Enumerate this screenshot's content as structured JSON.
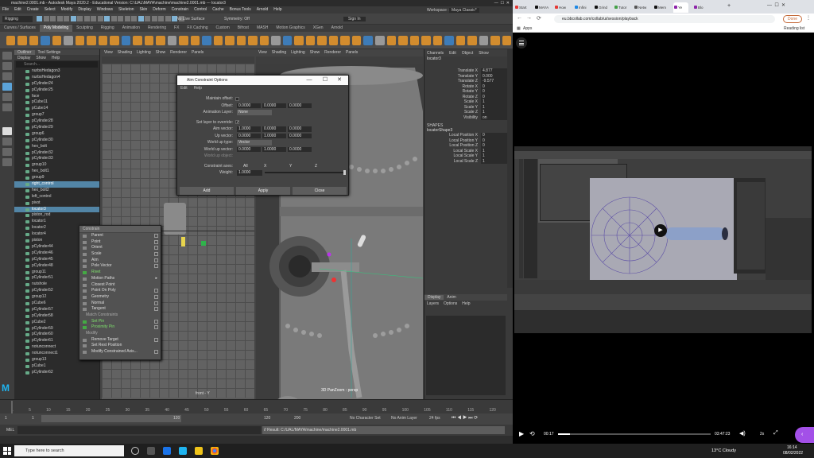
{
  "maya": {
    "title": "machine2.0001.mb - Autodesk Maya 2020.2 - Educational Version: C:\\UAL\\MAYA\\machine\\machine2.0001.mb --- locator3",
    "menu": [
      "File",
      "Edit",
      "Create",
      "Select",
      "Modify",
      "Display",
      "Windows",
      "Skeleton",
      "Skin",
      "Deform",
      "Constrain",
      "Control",
      "Cache",
      "Bonus Tools",
      "Arnold",
      "Help"
    ],
    "workspace_label": "Workspace :",
    "workspace_value": "Maya Classic*",
    "mode": "Rigging",
    "no_live_surface": "No Live Surface",
    "symmetry": "Symmetry: Off",
    "sign_in": "Sign In",
    "shelf_tabs": [
      "Curves / Surfaces",
      "Poly Modeling",
      "Sculpting",
      "Rigging",
      "Animation",
      "Rendering",
      "FX",
      "FX Caching",
      "Custom",
      "Bifrost",
      "MASH",
      "Motion Graphics",
      "XGen",
      "Arnold"
    ],
    "shelf_active": 1,
    "outliner": {
      "tabs": [
        "Outliner",
        "Tool Settings"
      ],
      "menus": [
        "Display",
        "Show",
        "Help"
      ],
      "search_placeholder": "Search...",
      "items": [
        "nurbsHedagon3",
        "nurbsHedagon4",
        "pCylinder24",
        "pCylinder25",
        "face",
        "pCube11",
        "pCube14",
        "group7",
        "pCylinder28",
        "pCylinder29",
        "group6",
        "pCylinder30",
        "hex_bolt",
        "pCylinder32",
        "pCylinder33",
        "group10",
        "hex_bolt1",
        "group9",
        "right_control",
        "hex_bolt2",
        "left_control",
        "pivot",
        "locator3",
        "piston_rod",
        "locator1",
        "locator2",
        "locator4",
        "piston",
        "pCylinder44",
        "pCylinder46",
        "pCylinder45",
        "pCylinder48",
        "group11",
        "pCylinder51",
        "nutshole",
        "pCylinder52",
        "group12",
        "pCube6",
        "pCylinder57",
        "pCylinder58",
        "pCube2",
        "pCylinder59",
        "pCylinder60",
        "pCylinder61",
        "notunconnect",
        "notunconnect1",
        "group13",
        "pCube1",
        "pCylinder62"
      ],
      "selected": [
        18,
        22
      ]
    },
    "viewport_menus": [
      "View",
      "Shading",
      "Lighting",
      "Show",
      "Renderer",
      "Panels"
    ],
    "vp1_label": "front - Y",
    "vp2_label": "3D PanZoom : persp",
    "channel_box": {
      "menus": [
        "Channels",
        "Edit",
        "Object",
        "Show"
      ],
      "object": "locator3",
      "rows": [
        [
          "Translate X",
          "4.877"
        ],
        [
          "Translate Y",
          "0.000"
        ],
        [
          "Translate Z",
          "-9.577"
        ],
        [
          "Rotate X",
          "0"
        ],
        [
          "Rotate Y",
          "0"
        ],
        [
          "Rotate Z",
          "0"
        ],
        [
          "Scale X",
          "1"
        ],
        [
          "Scale Y",
          "1"
        ],
        [
          "Scale Z",
          "1"
        ],
        [
          "Visibility",
          "on"
        ]
      ],
      "shapes_label": "SHAPES",
      "shape": "locatorShape3",
      "shape_rows": [
        [
          "Local Position X",
          "0"
        ],
        [
          "Local Position Y",
          "0"
        ],
        [
          "Local Position Z",
          "0"
        ],
        [
          "Local Scale X",
          "1"
        ],
        [
          "Local Scale Y",
          "1"
        ],
        [
          "Local Scale Z",
          "1"
        ]
      ],
      "layer_tabs": [
        "Display",
        "Anim"
      ],
      "layer_menus": [
        "Layers",
        "Options",
        "Help"
      ]
    },
    "timeline": {
      "ticks": [
        "1",
        "5",
        "10",
        "15",
        "20",
        "25",
        "30",
        "35",
        "40",
        "45",
        "50",
        "55",
        "60",
        "65",
        "70",
        "75",
        "80",
        "85",
        "90",
        "95",
        "100",
        "105",
        "110",
        "115",
        "120"
      ]
    },
    "range": {
      "start": "1",
      "inner_start": "1",
      "inner_end": "120",
      "end": "120",
      "end2": "200",
      "no_char": "No Character Set",
      "no_layer": "No Anim Layer",
      "fps": "24 fps"
    },
    "cmd_label": "MEL",
    "cmd_result": "// Result: C:/UAL/MAYA/machine/machine2.0001.mb"
  },
  "aim_dialog": {
    "title": "Aim Constraint Options",
    "menus": [
      "Edit",
      "Help"
    ],
    "rows": [
      {
        "label": "Maintain offset:",
        "values": []
      },
      {
        "label": "Offset:",
        "values": [
          "0.0000",
          "0.0000",
          "0.0000"
        ]
      },
      {
        "label": "Animation Layer:",
        "values": [
          "None"
        ]
      },
      {
        "label": "Set layer to override:",
        "values": []
      },
      {
        "label": "Aim vector:",
        "values": [
          "1.0000",
          "0.0000",
          "0.0000"
        ]
      },
      {
        "label": "Up vector:",
        "values": [
          "0.0000",
          "1.0000",
          "0.0000"
        ]
      },
      {
        "label": "World up type:",
        "values": [
          "Vector"
        ]
      },
      {
        "label": "World up vector:",
        "values": [
          "0.0000",
          "1.0000",
          "0.0000"
        ]
      },
      {
        "label": "World up object:",
        "values": []
      },
      {
        "label": "Constraint axes:",
        "values": [
          "All",
          "X",
          "Y",
          "Z"
        ]
      },
      {
        "label": "Weight:",
        "values": [
          "1.0000"
        ]
      }
    ],
    "buttons": [
      "Add",
      "Apply",
      "Close"
    ]
  },
  "constrain_menu": {
    "title": "Constrain",
    "items": [
      {
        "label": "Parent",
        "style": "normal",
        "box": true
      },
      {
        "label": "Point",
        "style": "normal",
        "box": true
      },
      {
        "label": "Orient",
        "style": "normal",
        "box": true
      },
      {
        "label": "Scale",
        "style": "normal",
        "box": true
      },
      {
        "label": "Aim",
        "style": "normal",
        "box": true
      },
      {
        "label": "Pole Vector",
        "style": "normal",
        "box": true
      },
      {
        "label": "Rivet",
        "style": "green",
        "box": false
      },
      {
        "label": "Motion Paths",
        "style": "normal",
        "box": false
      },
      {
        "label": "Closest Point",
        "style": "normal",
        "box": false
      },
      {
        "label": "Point On Poly",
        "style": "normal",
        "box": true
      },
      {
        "label": "Geometry",
        "style": "normal",
        "box": true
      },
      {
        "label": "Normal",
        "style": "normal",
        "box": true
      },
      {
        "label": "Tangent",
        "style": "normal",
        "box": true
      },
      {
        "label": "Match Constraints",
        "style": "hdr",
        "box": false
      },
      {
        "label": "Set Pin",
        "style": "green",
        "box": true
      },
      {
        "label": "Proximity Pin",
        "style": "green",
        "box": true
      },
      {
        "label": "Modify",
        "style": "hdr",
        "box": false
      },
      {
        "label": "Remove Target",
        "style": "normal",
        "box": true
      },
      {
        "label": "Set Rest Position",
        "style": "normal",
        "box": false
      },
      {
        "label": "Modify Constrained Axis...",
        "style": "normal",
        "box": true
      }
    ]
  },
  "chrome": {
    "tabs": [
      {
        "label": "Start",
        "color": "#e53935"
      },
      {
        "label": "MAYA",
        "color": "#111111"
      },
      {
        "label": "How",
        "color": "#e53935"
      },
      {
        "label": "Infini",
        "color": "#1e88e5"
      },
      {
        "label": "Grind",
        "color": "#111111"
      },
      {
        "label": "Tutor",
        "color": "#43a047"
      },
      {
        "label": "Netw",
        "color": "#555555"
      },
      {
        "label": "Mem",
        "color": "#111111"
      },
      {
        "label": "Ye",
        "color": "#8e24aa"
      },
      {
        "label": "Blo",
        "color": "#8e24aa"
      }
    ],
    "active_tab": 8,
    "url": "eu.bbcollab.com/collab/ui/session/playback",
    "done_label": "Done",
    "apps_label": "Apps",
    "reading_list": "Reading list",
    "video_time": "00:17",
    "video_duration": "03:47:23",
    "speed": "2x",
    "progress": 0.08
  },
  "taskbar": {
    "search_placeholder": "Type here to search",
    "weather": "13°C Cloudy",
    "time": "16:14",
    "date": "08/02/2022"
  }
}
